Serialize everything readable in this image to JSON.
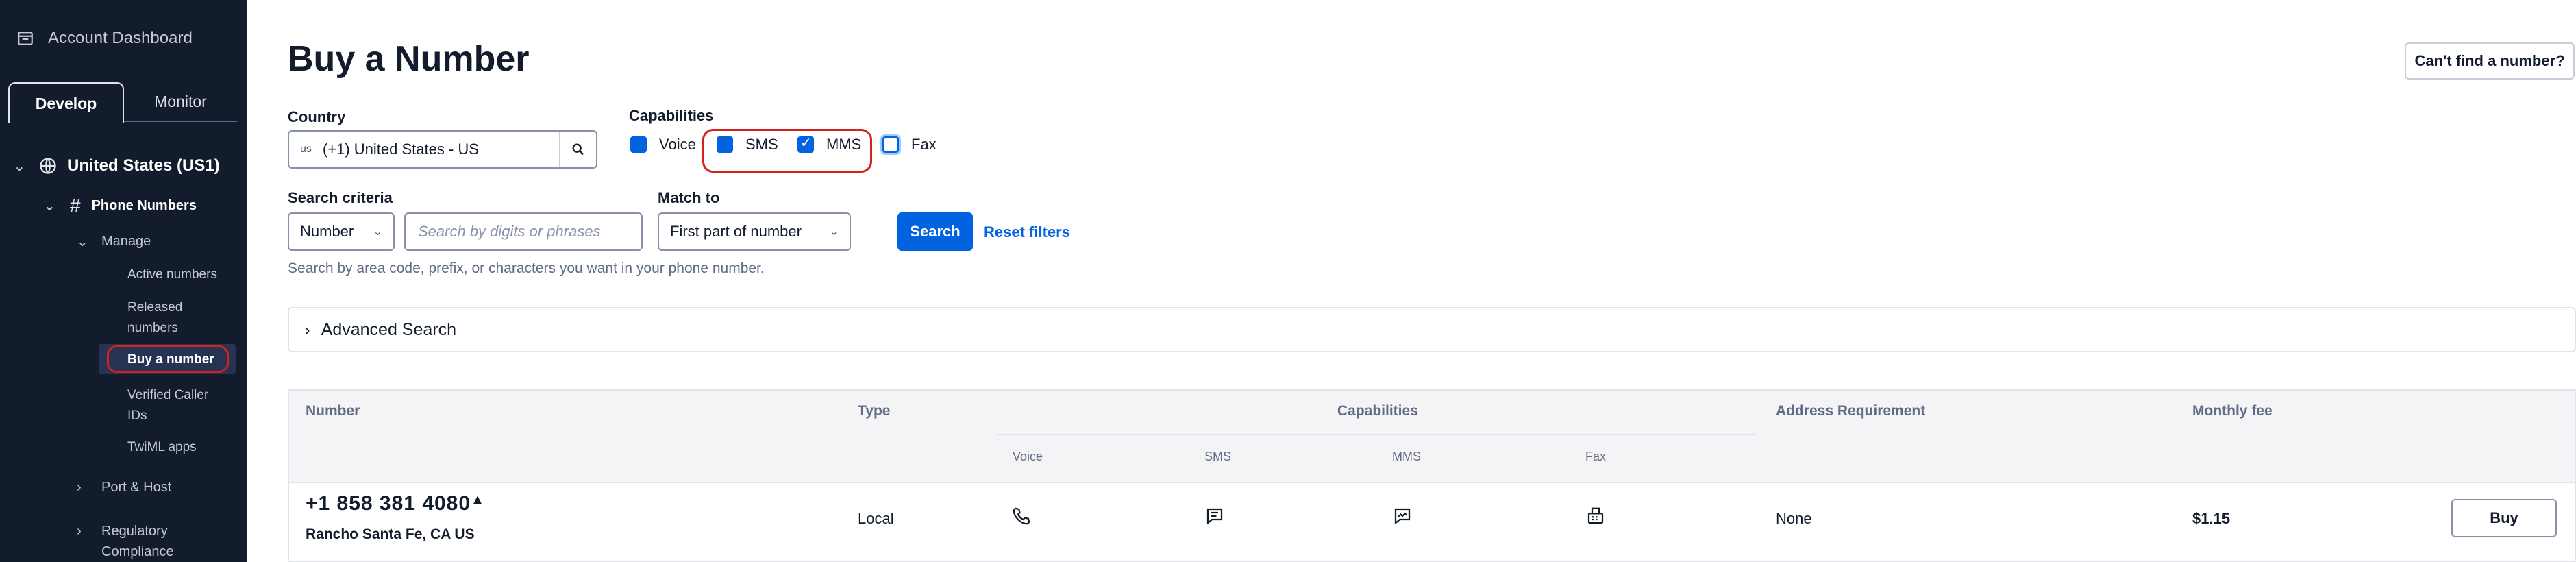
{
  "sidebar": {
    "account_label": "Account Dashboard",
    "tabs": [
      {
        "label": "Develop"
      },
      {
        "label": "Monitor"
      }
    ],
    "region": "United States (US1)",
    "phone_numbers": "Phone Numbers",
    "manage": "Manage",
    "sub_items": [
      {
        "label": "Active numbers"
      },
      {
        "label": "Released numbers"
      },
      {
        "label": "Buy a number"
      },
      {
        "label": "Verified Caller IDs"
      },
      {
        "label": "TwiML apps"
      }
    ],
    "port_host": "Port & Host",
    "regulatory": "Regulatory Compliance"
  },
  "header": {
    "title": "Buy a Number",
    "cant_find": "Can't find a number?"
  },
  "filters": {
    "country_label": "Country",
    "country_flag": "us",
    "country_value": "(+1) United States - US",
    "capabilities_label": "Capabilities",
    "capabilities": [
      {
        "label": "Voice",
        "checked": true
      },
      {
        "label": "SMS",
        "checked": true
      },
      {
        "label": "MMS",
        "checked": true
      },
      {
        "label": "Fax",
        "checked": false
      }
    ],
    "search_criteria_label": "Search criteria",
    "criteria_value": "Number",
    "search_placeholder": "Search by digits or phrases",
    "match_to_label": "Match to",
    "match_value": "First part of number",
    "search_button": "Search",
    "reset_link": "Reset filters",
    "hint": "Search by area code, prefix, or characters you want in your phone number.",
    "advanced": "Advanced Search"
  },
  "table": {
    "headers": {
      "number": "Number",
      "type": "Type",
      "capabilities": "Capabilities",
      "address": "Address Requirement",
      "fee": "Monthly fee"
    },
    "cap_headers": [
      "Voice",
      "SMS",
      "MMS",
      "Fax"
    ],
    "rows": [
      {
        "number": "+1 858 381 4080",
        "location": "Rancho Santa Fe, CA US",
        "type": "Local",
        "address": "None",
        "fee": "$1.15",
        "action": "Buy"
      }
    ]
  },
  "colors": {
    "accent": "#0263e0",
    "sidebar": "#121c2d",
    "highlight_ring": "#d61f1f"
  }
}
